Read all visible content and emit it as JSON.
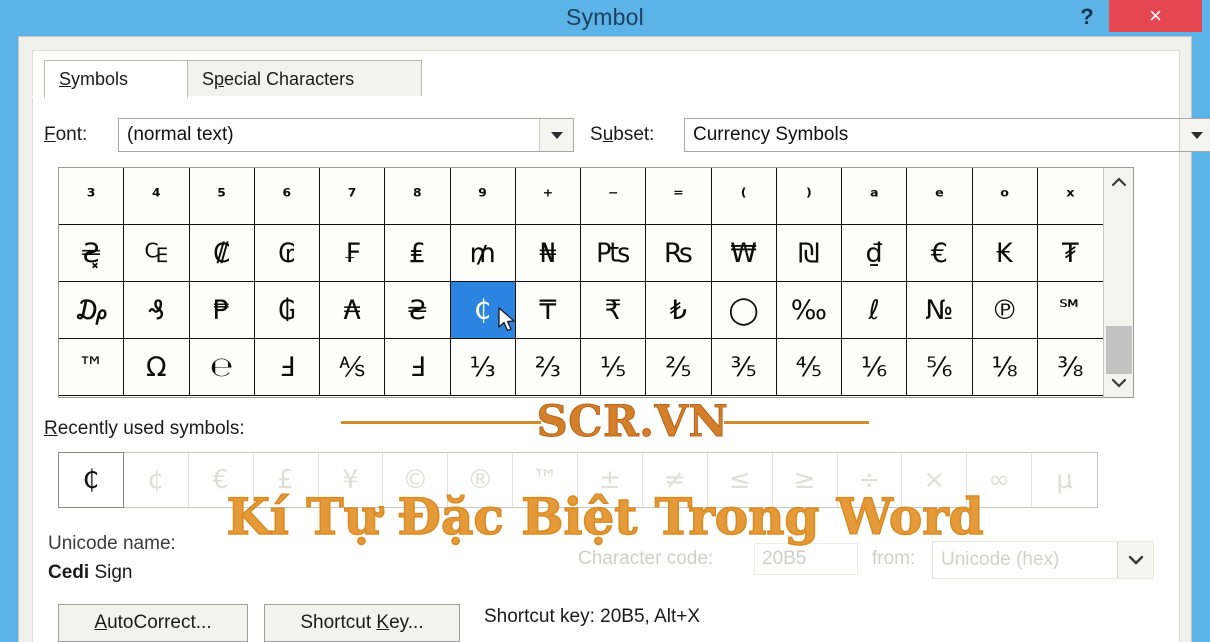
{
  "window": {
    "title": "Symbol",
    "help_label": "?",
    "close_label": "×",
    "titlebar_color": "#5cb3e8",
    "close_color": "#e4474f"
  },
  "tabs": [
    {
      "label": "Symbols",
      "accel": "S",
      "active": true
    },
    {
      "label": "Special Characters",
      "accel": "p",
      "active": false
    }
  ],
  "fields": {
    "font_label": "Font:",
    "font_accel": "F",
    "font_value": "(normal text)",
    "subset_label": "Subset:",
    "subset_accel": "u",
    "subset_value": "Currency Symbols"
  },
  "grid": {
    "columns": 16,
    "selected_index": 38,
    "selected_color": "#2a84e0",
    "rows": [
      [
        "³",
        "⁴",
        "⁵",
        "⁶",
        "⁷",
        "⁸",
        "⁹",
        "⁺",
        "⁻",
        "⁼",
        "⁽",
        "⁾",
        "ᵃ",
        "ᵉ",
        "ᵒ",
        "ˣ"
      ],
      [
        "₴͓",
        "₠",
        "₡",
        "₢",
        "₣",
        "₤",
        "₥",
        "₦",
        "₧",
        "₨",
        "₩",
        "₪",
        "₫",
        "€",
        "₭",
        "₮"
      ],
      [
        "₯",
        "₰",
        "₱",
        "₲",
        "₳",
        "₴",
        "₵",
        "₸",
        "₹",
        "₺",
        "◯",
        "‰",
        "ℓ",
        "№",
        "℗",
        "℠"
      ],
      [
        "™",
        "Ω",
        "℮",
        "Ⅎ",
        "⅍",
        "Ⅎ",
        "⅓",
        "⅔",
        "⅕",
        "⅖",
        "⅗",
        "⅘",
        "⅙",
        "⅚",
        "⅛",
        "⅜"
      ]
    ]
  },
  "scrollbar": {
    "up_label": "⌃",
    "down_label": "⌄"
  },
  "recent": {
    "label": "Recently used symbols:",
    "accel": "R",
    "symbols": [
      "₵",
      "¢",
      "€",
      "£",
      "¥",
      "©",
      "®",
      "™",
      "±",
      "≠",
      "≤",
      "≥",
      "÷",
      "×",
      "∞",
      "µ"
    ]
  },
  "unicode": {
    "name_label": "Unicode name:",
    "name_value_bold": "Cedi",
    "name_value_rest": "Sign",
    "charcode_label": "Character code:",
    "charcode_accel": "C",
    "charcode_value": "20B5",
    "from_label": "from:",
    "from_accel": "m",
    "from_value": "Unicode (hex)"
  },
  "buttons": {
    "autocorrect": "AutoCorrect...",
    "autocorrect_accel": "A",
    "shortcut_key": "Shortcut Key...",
    "shortcut_key_accel": "K",
    "shortcut_text": "Shortcut key: 20B5, Alt+X"
  },
  "watermark": {
    "brand": "SCR.VN",
    "brand_color": "#d4802a",
    "title": "Kí Tự Đặc Biệt Trong Word",
    "title_color": "#e59a3a"
  }
}
